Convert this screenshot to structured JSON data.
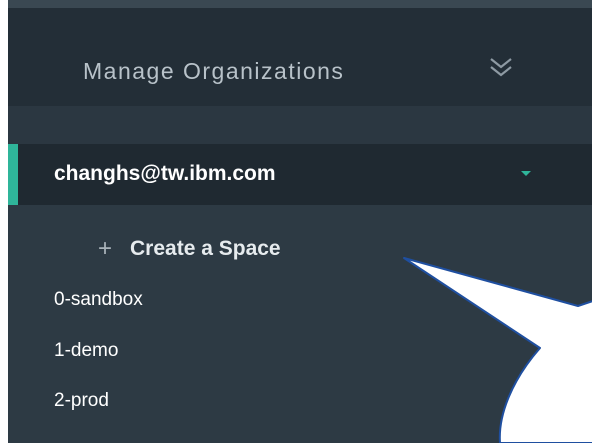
{
  "header": {
    "title": "Manage Organizations",
    "chevron_icon": "double-chevron-down-icon"
  },
  "org": {
    "name": "changhs@tw.ibm.com",
    "caret_icon": "caret-down-icon",
    "accent_color": "#2fb59a"
  },
  "spaces": {
    "create_icon": "plus-icon",
    "create_label": "Create a Space",
    "items": [
      {
        "label": "0-sandbox"
      },
      {
        "label": "1-demo"
      },
      {
        "label": "2-prod"
      }
    ]
  },
  "callout": {
    "fill": "#ffffff",
    "stroke": "#1f4fa0"
  }
}
